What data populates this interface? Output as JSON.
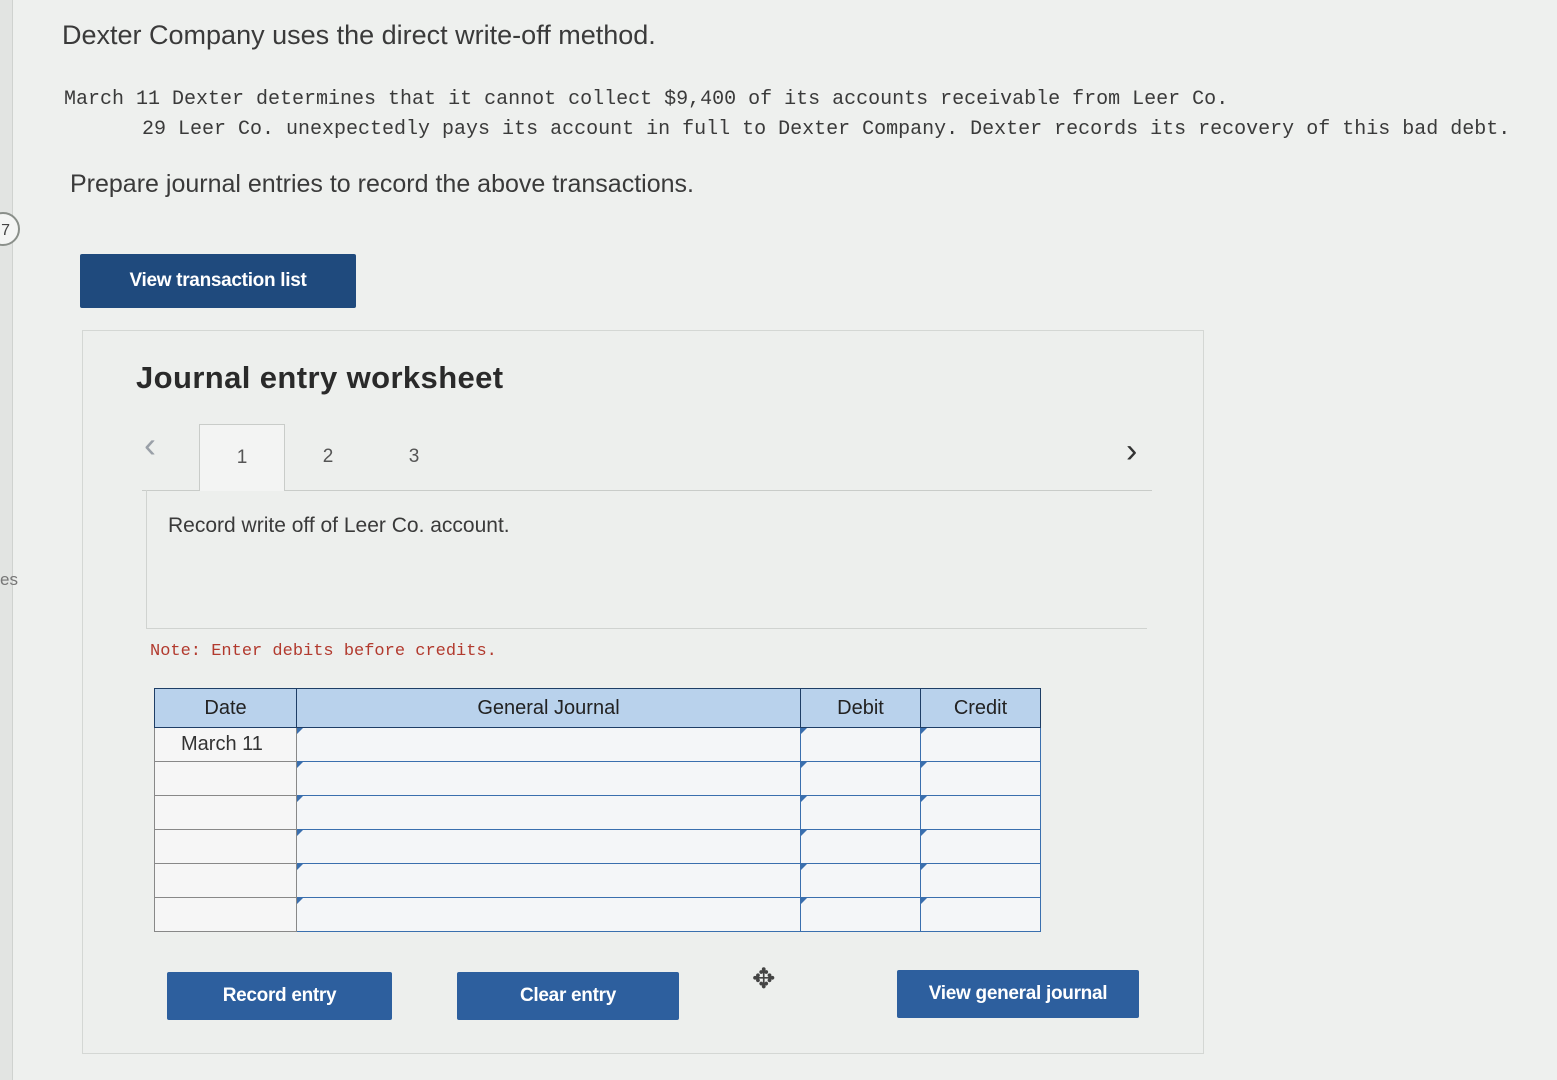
{
  "left_edge": {
    "badge": "7",
    "fragment": "es"
  },
  "problem": {
    "intro": "Dexter Company uses the direct write-off method.",
    "transactions": [
      "March 11 Dexter determines that it cannot collect $9,400 of its accounts receivable from Leer Co.",
      "29 Leer Co. unexpectedly pays its account in full to Dexter Company. Dexter records its recovery of this bad debt."
    ],
    "instruction": "Prepare journal entries to record the above transactions."
  },
  "buttons": {
    "view_transaction_list": "View transaction list",
    "record_entry": "Record entry",
    "clear_entry": "Clear entry",
    "view_general_journal": "View general journal"
  },
  "worksheet": {
    "title": "Journal entry worksheet",
    "tabs": [
      "1",
      "2",
      "3"
    ],
    "active_tab": "1",
    "prev_icon": "chevron-left-icon",
    "next_icon": "chevron-right-icon",
    "entry_instruction": "Record write off of Leer Co. account.",
    "note": "Note: Enter debits before credits.",
    "table": {
      "headers": [
        "Date",
        "General Journal",
        "Debit",
        "Credit"
      ],
      "rows": [
        {
          "date": "March 11",
          "account": "",
          "debit": "",
          "credit": ""
        },
        {
          "date": "",
          "account": "",
          "debit": "",
          "credit": ""
        },
        {
          "date": "",
          "account": "",
          "debit": "",
          "credit": ""
        },
        {
          "date": "",
          "account": "",
          "debit": "",
          "credit": ""
        },
        {
          "date": "",
          "account": "",
          "debit": "",
          "credit": ""
        },
        {
          "date": "",
          "account": "",
          "debit": "",
          "credit": ""
        }
      ]
    }
  },
  "colors": {
    "button_blue": "#2d5f9e",
    "header_blue": "#b9d2ec",
    "note_red": "#b23a2e"
  }
}
